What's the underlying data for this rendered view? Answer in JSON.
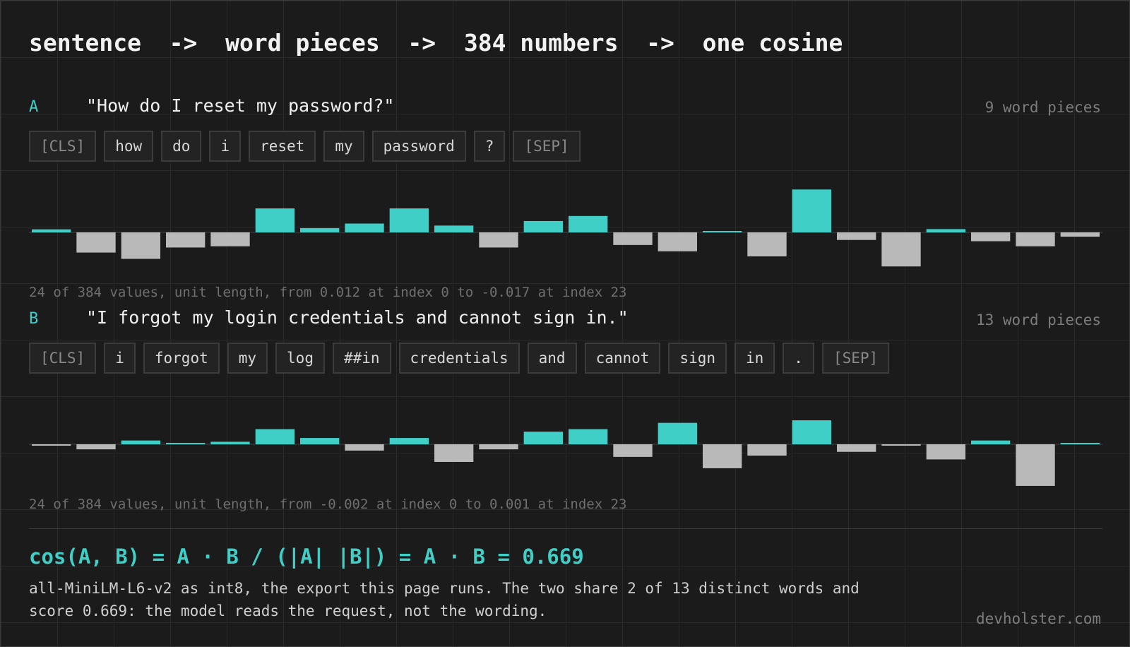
{
  "headline": "sentence  ->  word pieces  ->  384 numbers  ->  one cosine",
  "colors": {
    "accent": "#3fcfc7",
    "negative": "#b9b9b9",
    "background": "#1b1b1b"
  },
  "sentence_a": {
    "letter": "A",
    "text": "\"How do I reset my password?\"",
    "count_label": "9 word pieces",
    "tokens": [
      {
        "text": "[CLS]",
        "special": true
      },
      {
        "text": "how",
        "special": false
      },
      {
        "text": "do",
        "special": false
      },
      {
        "text": "i",
        "special": false
      },
      {
        "text": "reset",
        "special": false
      },
      {
        "text": "my",
        "special": false
      },
      {
        "text": "password",
        "special": false
      },
      {
        "text": "?",
        "special": false
      },
      {
        "text": "[SEP]",
        "special": true
      }
    ],
    "caption": "24 of 384 values, unit length, from 0.012 at index 0 to -0.017 at index 23"
  },
  "sentence_b": {
    "letter": "B",
    "text": "\"I forgot my login credentials and cannot sign in.\"",
    "count_label": "13 word pieces",
    "tokens": [
      {
        "text": "[CLS]",
        "special": true
      },
      {
        "text": "i",
        "special": false
      },
      {
        "text": "forgot",
        "special": false
      },
      {
        "text": "my",
        "special": false
      },
      {
        "text": "log",
        "special": false
      },
      {
        "text": "##in",
        "special": false
      },
      {
        "text": "credentials",
        "special": false
      },
      {
        "text": "and",
        "special": false
      },
      {
        "text": "cannot",
        "special": false
      },
      {
        "text": "sign",
        "special": false
      },
      {
        "text": "in",
        "special": false
      },
      {
        "text": ".",
        "special": false
      },
      {
        "text": "[SEP]",
        "special": true
      }
    ],
    "caption": "24 of 384 values, unit length, from -0.002 at index 0 to 0.001 at index 23"
  },
  "chart_data": [
    {
      "type": "bar",
      "name": "A",
      "categories": [
        0,
        1,
        2,
        3,
        4,
        5,
        6,
        7,
        8,
        9,
        10,
        11,
        12,
        13,
        14,
        15,
        16,
        17,
        18,
        19,
        20,
        21,
        22,
        23
      ],
      "values": [
        0.012,
        -0.08,
        -0.105,
        -0.06,
        -0.055,
        0.095,
        0.017,
        0.035,
        0.095,
        0.027,
        -0.06,
        0.045,
        0.065,
        -0.05,
        -0.075,
        0.003,
        -0.095,
        0.17,
        -0.03,
        -0.135,
        0.013,
        -0.035,
        -0.055,
        -0.017
      ],
      "ylim": [
        -0.21,
        0.21
      ]
    },
    {
      "type": "bar",
      "name": "B",
      "categories": [
        0,
        1,
        2,
        3,
        4,
        5,
        6,
        7,
        8,
        9,
        10,
        11,
        12,
        13,
        14,
        15,
        16,
        17,
        18,
        19,
        20,
        21,
        22,
        23
      ],
      "values": [
        -0.002,
        -0.02,
        0.015,
        0.005,
        0.01,
        0.06,
        0.025,
        -0.025,
        0.025,
        -0.07,
        -0.02,
        0.05,
        0.06,
        -0.05,
        0.085,
        -0.095,
        -0.045,
        0.095,
        -0.03,
        -0.002,
        -0.06,
        0.015,
        -0.165,
        0.001
      ],
      "ylim": [
        -0.21,
        0.21
      ]
    }
  ],
  "formula": "cos(A, B) = A · B / (|A| |B|) = A · B = 0.669",
  "note_lines": [
    "all-MiniLM-L6-v2 as int8, the export this page runs. The two share 2 of 13 distinct words and",
    "score 0.669: the model reads the request, not the wording."
  ],
  "site": "devholster.com"
}
